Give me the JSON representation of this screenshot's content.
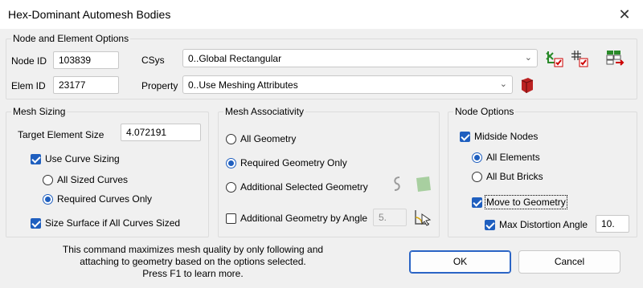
{
  "window": {
    "title": "Hex-Dominant Automesh Bodies",
    "close_glyph": "✕"
  },
  "node_element": {
    "group_label": "Node and Element Options",
    "node_id_label": "Node ID",
    "node_id_value": "103839",
    "elem_id_label": "Elem ID",
    "elem_id_value": "23177",
    "csys_label": "CSys",
    "csys_value": "0..Global Rectangular",
    "property_label": "Property",
    "property_value": "0..Use Meshing Attributes"
  },
  "mesh_sizing": {
    "group_label": "Mesh Sizing",
    "target_label": "Target Element Size",
    "target_value": "4.072191",
    "use_curve_sizing": "Use Curve Sizing",
    "all_sized_curves": "All Sized Curves",
    "required_curves_only": "Required Curves Only",
    "size_surface": "Size Surface if All Curves Sized"
  },
  "mesh_assoc": {
    "group_label": "Mesh Associativity",
    "all_geometry": "All Geometry",
    "required_geometry_only": "Required Geometry Only",
    "additional_selected": "Additional Selected Geometry",
    "additional_by_angle": "Additional Geometry by Angle",
    "angle_value": "5."
  },
  "node_options": {
    "group_label": "Node Options",
    "midside_nodes": "Midside Nodes",
    "all_elements": "All Elements",
    "all_but_bricks": "All But Bricks",
    "move_to_geometry": "Move to Geometry",
    "max_distortion_label": "Max Distortion Angle",
    "max_distortion_value": "10."
  },
  "help_text": {
    "line1": "This command maximizes mesh quality by only following and",
    "line2": "attaching to geometry based on the options selected.",
    "line3": "Press F1 to learn more."
  },
  "buttons": {
    "ok": "OK",
    "cancel": "Cancel"
  },
  "icons": {
    "csys_pick": "coordinate-axes-icon",
    "csys_new": "grid-check-icon",
    "csys_list": "grid-list-icon",
    "property_new": "property-solid-icon",
    "select_curves": "curve-select-icon",
    "select_surfaces": "surface-select-icon",
    "angle_pick": "angle-pick-icon"
  },
  "colors": {
    "accent": "#1f5fbf",
    "window_bg": "#f0f0f0"
  }
}
